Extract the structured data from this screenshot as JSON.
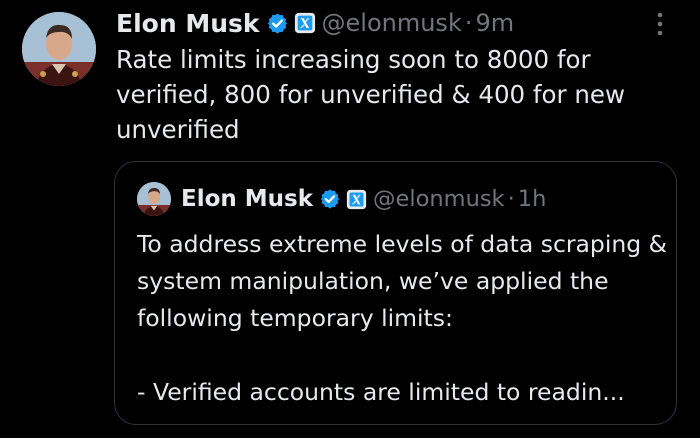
{
  "tweet": {
    "author_name": "Elon Musk",
    "handle": "@elonmusk",
    "separator": "·",
    "time": "9m",
    "text": "Rate limits increasing soon to 8000 for verified, 800 for unverified & 400 for new unverified",
    "colors": {
      "background": "#000000",
      "text": "#e7e9ea",
      "muted": "#71767b",
      "verified_badge": "#1d9bf0",
      "border": "#2f3336"
    }
  },
  "quoted_tweet": {
    "author_name": "Elon Musk",
    "handle": "@elonmusk",
    "separator": "·",
    "time": "1h",
    "text": "To address extreme levels of data scraping & system manipulation, we’ve applied the following temporary limits:\n\n- Verified accounts are limited to readin..."
  },
  "icons": {
    "verified": "verified-badge-icon",
    "affiliation": "x-affiliation-icon",
    "more": "more-options-icon"
  }
}
